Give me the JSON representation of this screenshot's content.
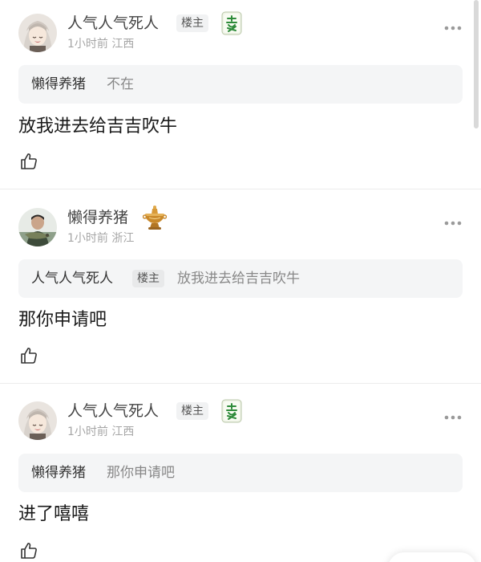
{
  "posts": [
    {
      "username": "人气人气死人",
      "op_badge": "楼主",
      "decor_icon": "mahjong-fa-tile-icon",
      "time": "1小时前",
      "location": "江西",
      "quote": {
        "username": "懒得养猪",
        "has_op_badge": false,
        "text": "不在"
      },
      "content": "放我进去给吉吉吹牛"
    },
    {
      "username": "懒得养猪",
      "op_badge": "",
      "decor_icon": "golden-hotpot-icon",
      "time": "1小时前",
      "location": "浙江",
      "quote": {
        "username": "人气人气死人",
        "op_badge": "楼主",
        "text": "放我进去给吉吉吹牛"
      },
      "content": "那你申请吧"
    },
    {
      "username": "人气人气死人",
      "op_badge": "楼主",
      "decor_icon": "mahjong-fa-tile-icon",
      "time": "1小时前",
      "location": "江西",
      "quote": {
        "username": "懒得养猪",
        "has_op_badge": false,
        "text": "那你申请吧"
      },
      "content": "进了嘻嘻"
    }
  ],
  "colors": {
    "tile_green": "#2e8b3a",
    "hotpot_gold": "#c9892b",
    "quote_bg": "#f4f5f6"
  }
}
